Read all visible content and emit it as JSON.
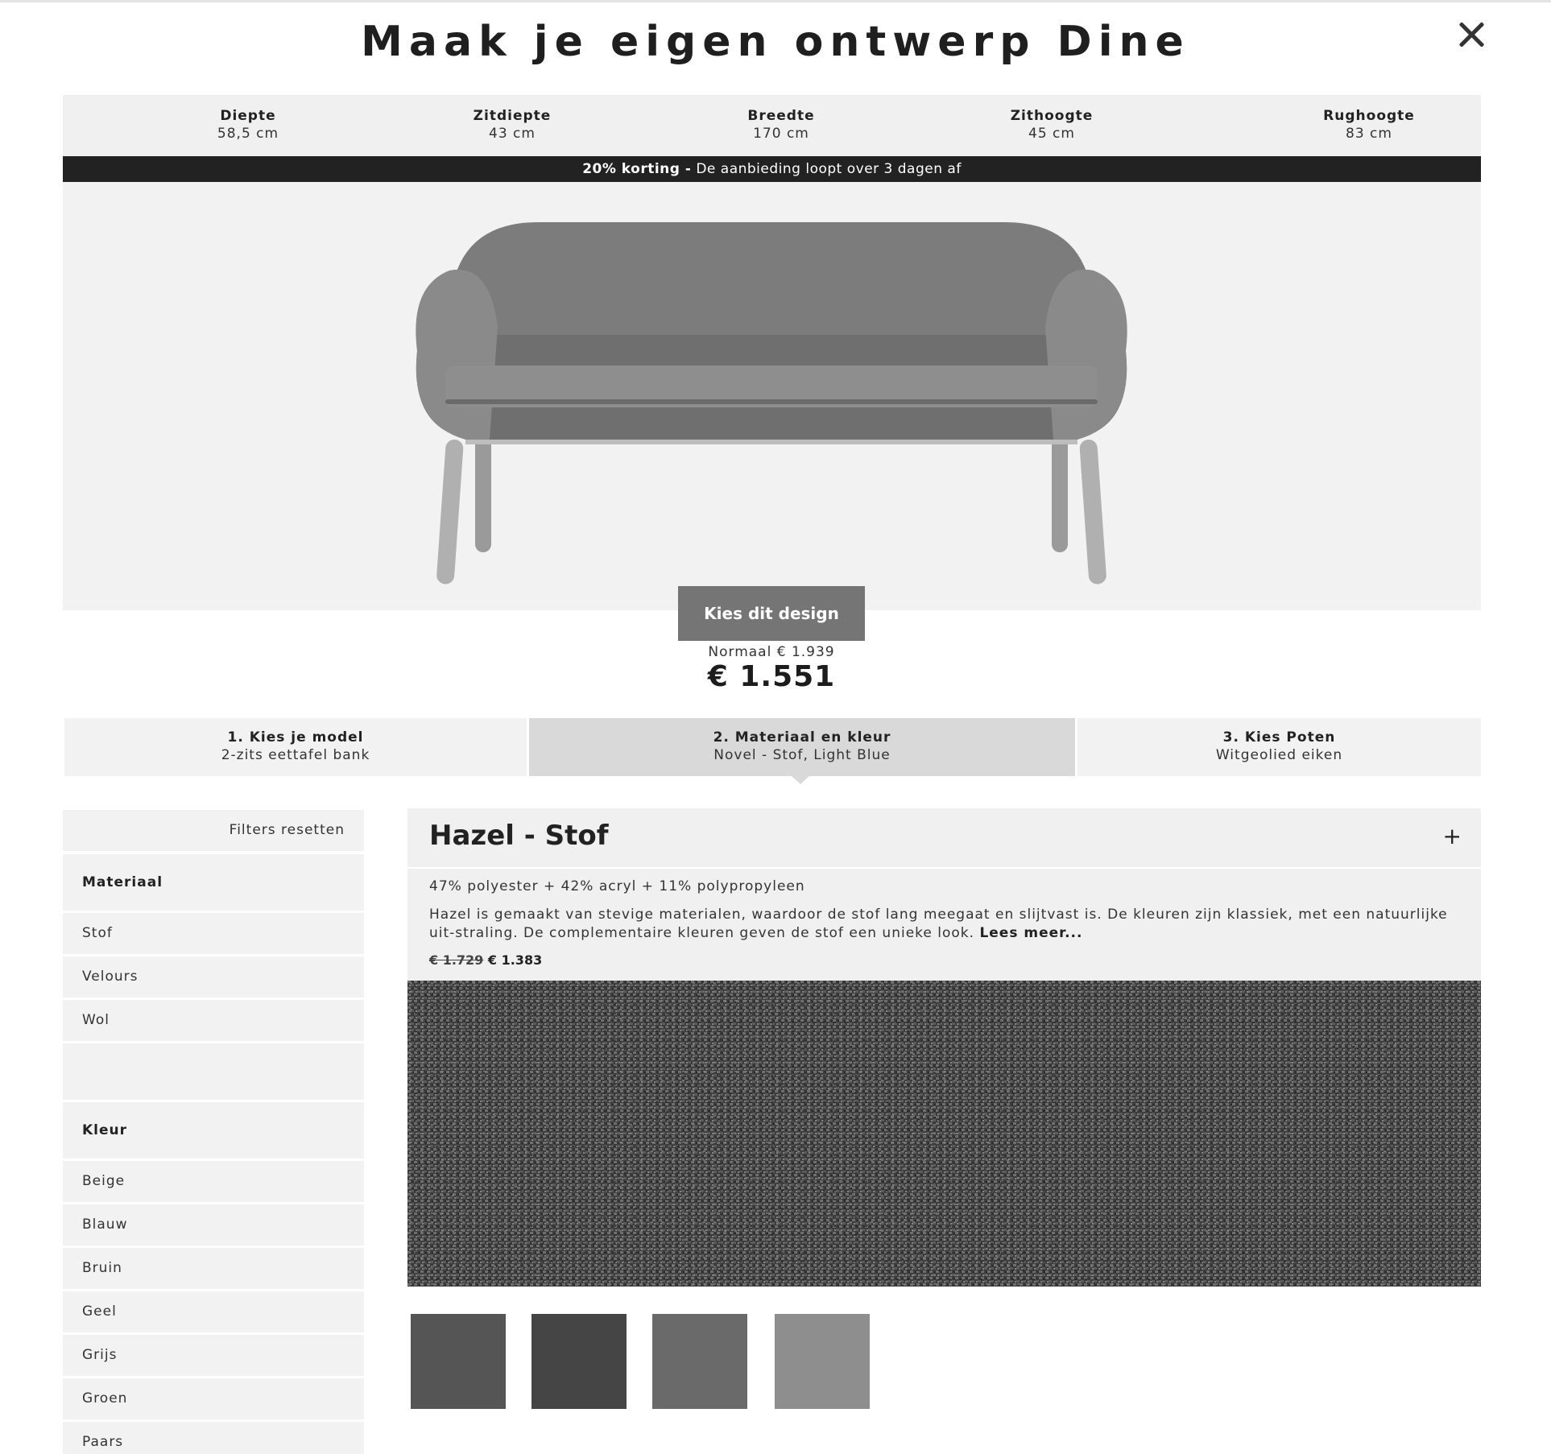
{
  "header": {
    "title": "Maak je eigen ontwerp Dine"
  },
  "dimensions": [
    {
      "label": "Diepte",
      "value": "58,5 cm"
    },
    {
      "label": "Zitdiepte",
      "value": "43 cm"
    },
    {
      "label": "Breedte",
      "value": "170 cm"
    },
    {
      "label": "Zithoogte",
      "value": "45 cm"
    },
    {
      "label": "Rughoogte",
      "value": "83 cm"
    }
  ],
  "promo": {
    "bold": "20% korting -",
    "text": " De aanbieding loopt over 3 dagen af"
  },
  "cta": {
    "label": "Kies dit design"
  },
  "price": {
    "normal": "Normaal € 1.939",
    "current": "€ 1.551"
  },
  "steps": [
    {
      "title": "1. Kies je model",
      "subtitle": "2-zits eettafel bank"
    },
    {
      "title": "2. Materiaal en kleur",
      "subtitle": "Novel - Stof, Light Blue"
    },
    {
      "title": "3. Kies Poten",
      "subtitle": "Witgeolied eiken"
    }
  ],
  "filters": {
    "reset": "Filters resetten",
    "material_heading": "Materiaal",
    "materials": [
      "Stof",
      "Velours",
      "Wol"
    ],
    "color_heading": "Kleur",
    "colors": [
      "Beige",
      "Blauw",
      "Bruin",
      "Geel",
      "Grijs",
      "Groen",
      "Paars"
    ]
  },
  "material": {
    "title": "Hazel - Stof",
    "composition": "47% polyester + 42% acryl + 11% polypropyleen",
    "description": "Hazel is gemaakt van stevige materialen, waardoor de stof lang meegaat en slijtvast is. De kleuren zijn klassiek, met een natuurlijke uit-straling. De complementaire kleuren geven de stof een unieke look.",
    "read_more": "Lees meer...",
    "old_price": "€ 1.729",
    "new_price": "€ 1.383"
  },
  "swatches": [
    "#555555",
    "#454545",
    "#6a6a6a",
    "#8e8e8e"
  ],
  "colors": {
    "promo_bg": "#222222",
    "button_bg": "#757575",
    "panel_bg": "#f2f2f2",
    "active_step": "#d9d9d9"
  }
}
